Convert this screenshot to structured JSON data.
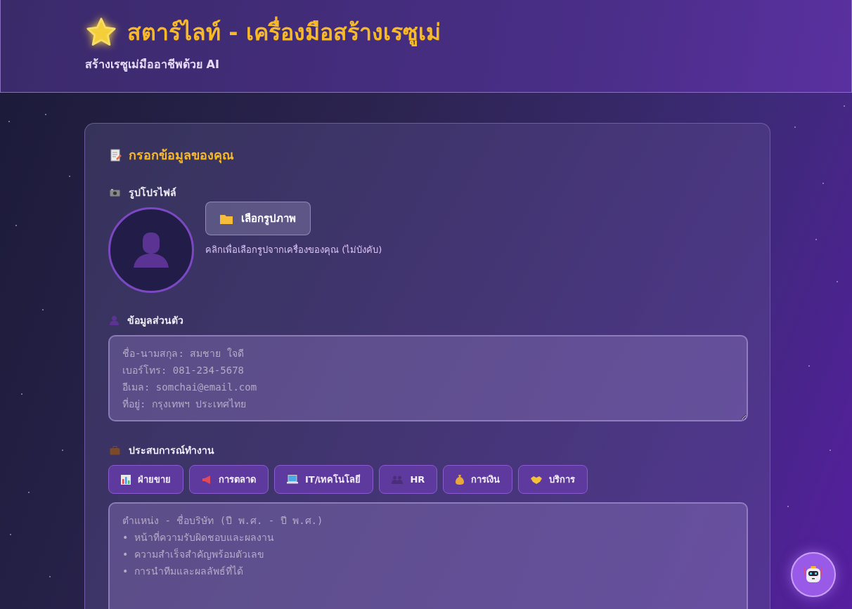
{
  "header": {
    "title": "สตาร์ไลท์ - เครื่องมือสร้างเรซูเม่",
    "subtitle": "สร้างเรซูเม่มืออาชีพด้วย AI"
  },
  "form": {
    "title": "กรอกข้อมูลของคุณ",
    "profile": {
      "label": "รูปโปรไฟล์",
      "button": "เลือกรูปภาพ",
      "hint": "คลิกเพื่อเลือกรูปจากเครื่องของคุณ (ไม่บังคับ)"
    },
    "personal": {
      "label": "ข้อมูลส่วนตัว",
      "placeholder": "ชื่อ-นามสกุล: สมชาย ใจดี\nเบอร์โทร: 081-234-5678\nอีเมล: somchai@email.com\nที่อยู่: กรุงเทพฯ ประเทศไทย"
    },
    "experience": {
      "label": "ประสบการณ์ทำงาน",
      "chips": [
        "ฝ่ายขาย",
        "การตลาด",
        "IT/เทคโนโลยี",
        "HR",
        "การเงิน",
        "บริการ"
      ],
      "placeholder": "ตำแหน่ง - ชื่อบริษัท (ปี พ.ศ. - ปี พ.ศ.)\n• หน้าที่ความรับผิดชอบและผลงาน\n• ความสำเร็จสำคัญพร้อมตัวเลข\n• การนำทีมและผลลัพธ์ที่ได้"
    }
  }
}
